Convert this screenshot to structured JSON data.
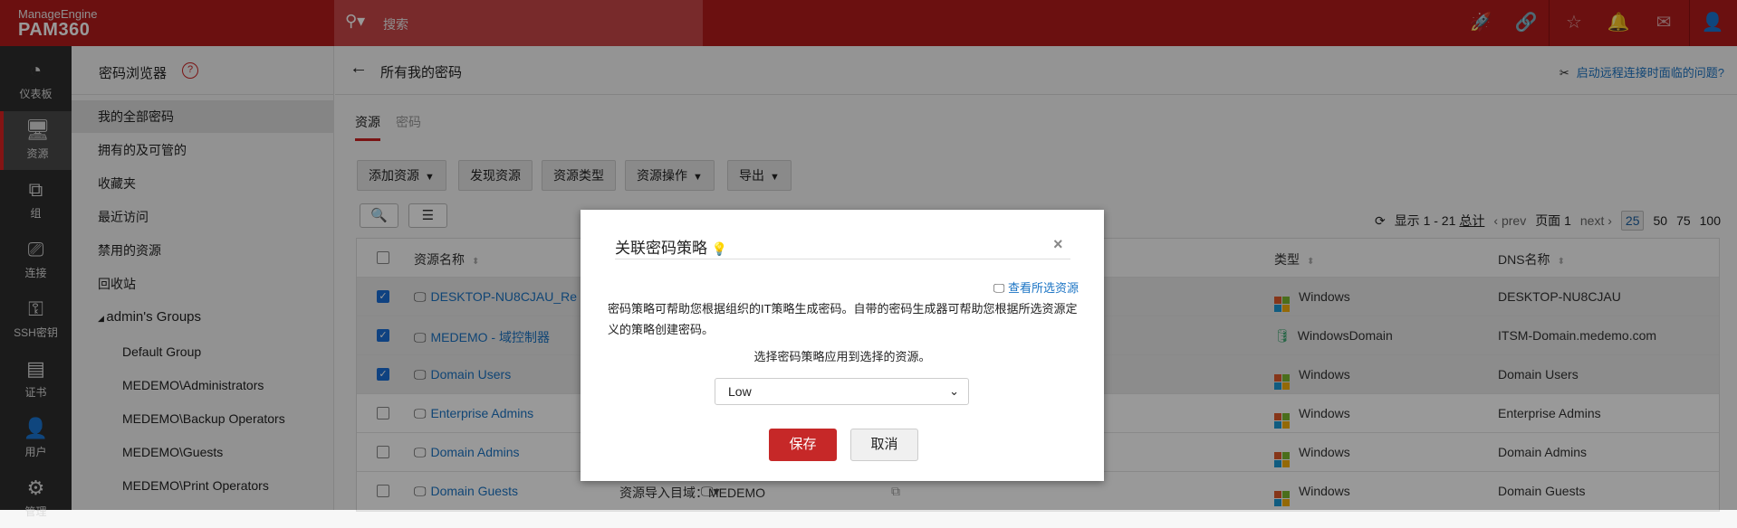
{
  "topbar": {
    "brand": "ManageEngine",
    "product": "PAM360",
    "search_placeholder": "搜索"
  },
  "nav": [
    {
      "icon": "dashboard-icon",
      "glyph": "◔",
      "label": "仪表板"
    },
    {
      "icon": "monitor-icon",
      "glyph": "🖥",
      "label": "资源",
      "selected": true
    },
    {
      "icon": "group-icon",
      "glyph": "⧉",
      "label": "组"
    },
    {
      "icon": "connect-icon",
      "glyph": "⎚",
      "label": "连接"
    },
    {
      "icon": "ssh-key-icon",
      "glyph": "⚿",
      "label": "SSH密钥"
    },
    {
      "icon": "certificate-icon",
      "glyph": "▤",
      "label": "证书"
    },
    {
      "icon": "user-icon",
      "glyph": "👤",
      "label": "用户"
    },
    {
      "icon": "gear-icon",
      "glyph": "⚙",
      "label": "管理"
    }
  ],
  "sidebar": {
    "title": "密码浏览器",
    "help": "?",
    "items": [
      "我的全部密码",
      "拥有的及可管的",
      "收藏夹",
      "最近访问",
      "禁用的资源",
      "回收站"
    ],
    "group_header": "admin's Groups",
    "groups": [
      "Default Group",
      "MEDEMO\\Administrators",
      "MEDEMO\\Backup Operators",
      "MEDEMO\\Guests",
      "MEDEMO\\Print Operators"
    ]
  },
  "main": {
    "title": "所有我的密码",
    "help_link": "启动远程连接时面临的问题?",
    "tabs": [
      "资源",
      "密码"
    ],
    "toolbar": [
      "添加资源",
      "发现资源",
      "资源类型",
      "资源操作",
      "导出"
    ],
    "pager": {
      "showing": "显示 1 - 21",
      "total": "总计",
      "prev": "prev",
      "page": "页面 1",
      "next": "next",
      "sizes": [
        "25",
        "50",
        "75",
        "100"
      ]
    },
    "columns": {
      "name": "资源名称",
      "type": "类型",
      "dns": "DNS名称"
    },
    "rows": [
      {
        "name": "DESKTOP-NU8CJAU_Re",
        "type": "Windows",
        "dns": "DESKTOP-NU8CJAU",
        "checked": true
      },
      {
        "name": "MEDEMO - 域控制器",
        "type": "WindowsDomain",
        "dns": "ITSM-Domain.medemo.com",
        "checked": true
      },
      {
        "name": "Domain Users",
        "type": "Windows",
        "dns": "Domain Users",
        "checked": true
      },
      {
        "name": "Enterprise Admins",
        "type": "Windows",
        "dns": "Enterprise Admins",
        "checked": false
      },
      {
        "name": "Domain Admins",
        "type": "Windows",
        "dns": "Domain Admins",
        "checked": false
      },
      {
        "name": "Domain Guests",
        "type": "Windows",
        "dns": "Domain Guests",
        "desc": "资源导入目域：MEDEMO",
        "checked": false
      }
    ]
  },
  "modal": {
    "title": "关联密码策略",
    "view_link": "查看所选资源",
    "description": "密码策略可帮助您根据组织的IT策略生成密码。自带的密码生成器可帮助您根据所选资源定义的策略创建密码。",
    "prompt": "选择密码策略应用到选择的资源。",
    "policy_value": "Low",
    "save": "保存",
    "cancel": "取消"
  }
}
